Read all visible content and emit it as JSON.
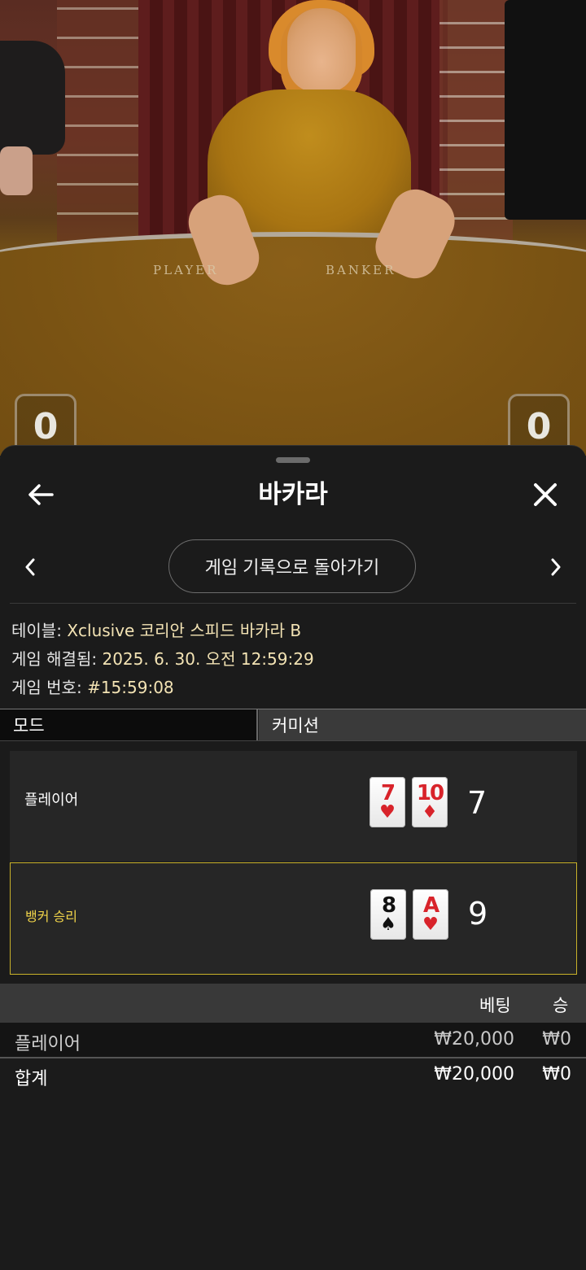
{
  "video": {
    "felt_left": "PLAYER",
    "felt_right": "BANKER",
    "score_left": "0",
    "score_right": "0"
  },
  "sheet": {
    "title": "바카라",
    "history_button": "게임 기록으로 돌아가기"
  },
  "info": {
    "table_label": "테이블:",
    "table_value": "Xclusive 코리안 스피드 바카라 B",
    "resolved_label": "게임 해결됨:",
    "resolved_value": "2025. 6. 30. 오전 12:59:29",
    "number_label": "게임 번호:",
    "number_value": "#15:59:08"
  },
  "mode": {
    "left": "모드",
    "right": "커미션"
  },
  "hands": {
    "player": {
      "label": "플레이어",
      "cards": [
        {
          "rank": "7",
          "suit": "♥",
          "color": "#d8232a"
        },
        {
          "rank": "10",
          "suit": "♦",
          "color": "#d8232a"
        }
      ],
      "total": "7"
    },
    "banker": {
      "label": "뱅커 승리",
      "cards": [
        {
          "rank": "8",
          "suit": "♠",
          "color": "#111111"
        },
        {
          "rank": "A",
          "suit": "♥",
          "color": "#d8232a"
        }
      ],
      "total": "9"
    }
  },
  "bets": {
    "header_bet": "베팅",
    "header_win": "승",
    "rows": [
      {
        "label": "플레이어",
        "bet": "₩20,000",
        "win": "₩0"
      }
    ],
    "total": {
      "label": "합계",
      "bet": "₩20,000",
      "win": "₩0"
    }
  },
  "colors": {
    "accent_gold": "#c9b22a",
    "winner_text": "#f1d44a",
    "info_value": "#f3e3b4"
  }
}
